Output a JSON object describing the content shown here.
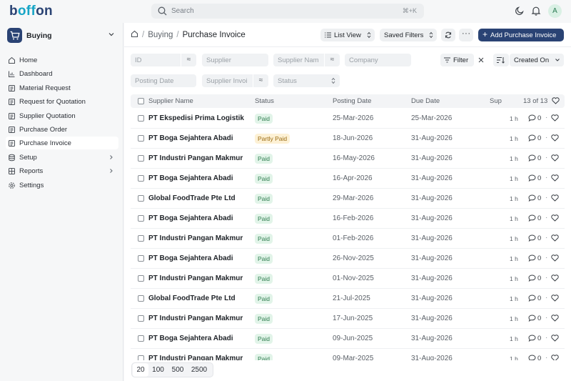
{
  "app": {
    "logo_prefix": "b",
    "logo_oo": "off",
    "logo_suffix": "on"
  },
  "search": {
    "placeholder": "Search",
    "shortcut": "⌘+K"
  },
  "user": {
    "avatar_letter": "A"
  },
  "workspace": {
    "label": "Buying"
  },
  "sidebar": {
    "items": [
      {
        "label": "Home",
        "icon": "home-icon"
      },
      {
        "label": "Dashboard",
        "icon": "chart-icon"
      },
      {
        "label": "Material Request",
        "icon": "doc-icon"
      },
      {
        "label": "Request for Quotation",
        "icon": "doc-icon"
      },
      {
        "label": "Supplier Quotation",
        "icon": "doc-icon"
      },
      {
        "label": "Purchase Order",
        "icon": "doc-icon"
      },
      {
        "label": "Purchase Invoice",
        "icon": "doc-icon",
        "active": true
      },
      {
        "label": "Setup",
        "icon": "db-icon",
        "chevron": true
      },
      {
        "label": "Reports",
        "icon": "grid-icon",
        "chevron": true
      },
      {
        "label": "Settings",
        "icon": "gear-icon"
      }
    ]
  },
  "breadcrumb": {
    "parent": "Buying",
    "current": "Purchase Invoice"
  },
  "toolbar": {
    "list_view": "List View",
    "saved_filters": "Saved Filters",
    "add_button": "Add Purchase Invoice"
  },
  "filters": {
    "id": "ID",
    "supplier": "Supplier",
    "supplier_name": "Supplier Nam",
    "company": "Company",
    "posting_date": "Posting Date",
    "supplier_invoice": "Supplier Invoi",
    "status": "Status",
    "filter_label": "Filter",
    "sort_label": "Created On"
  },
  "table": {
    "columns": {
      "supplier_name": "Supplier Name",
      "status": "Status",
      "posting_date": "Posting Date",
      "due_date": "Due Date",
      "sup": "Sup",
      "count": "13 of 13"
    },
    "rows": [
      {
        "name": "PT Ekspedisi Prima Logistik",
        "status": "Paid",
        "posting": "25-Mar-2026",
        "due": "25-Mar-2026",
        "age": "1 h",
        "comments": "0"
      },
      {
        "name": "PT Boga Sejahtera Abadi",
        "status": "Partly Paid",
        "posting": "18-Jun-2026",
        "due": "31-Aug-2026",
        "age": "1 h",
        "comments": "0"
      },
      {
        "name": "PT Industri Pangan Makmur",
        "status": "Paid",
        "posting": "16-May-2026",
        "due": "31-Aug-2026",
        "age": "1 h",
        "comments": "0"
      },
      {
        "name": "PT Boga Sejahtera Abadi",
        "status": "Paid",
        "posting": "16-Apr-2026",
        "due": "31-Aug-2026",
        "age": "1 h",
        "comments": "0"
      },
      {
        "name": "Global FoodTrade Pte Ltd",
        "status": "Paid",
        "posting": "29-Mar-2026",
        "due": "31-Aug-2026",
        "age": "1 h",
        "comments": "0"
      },
      {
        "name": "PT Boga Sejahtera Abadi",
        "status": "Paid",
        "posting": "16-Feb-2026",
        "due": "31-Aug-2026",
        "age": "1 h",
        "comments": "0"
      },
      {
        "name": "PT Industri Pangan Makmur",
        "status": "Paid",
        "posting": "01-Feb-2026",
        "due": "31-Aug-2026",
        "age": "1 h",
        "comments": "0"
      },
      {
        "name": "PT Boga Sejahtera Abadi",
        "status": "Paid",
        "posting": "26-Nov-2025",
        "due": "31-Aug-2026",
        "age": "1 h",
        "comments": "0"
      },
      {
        "name": "PT Industri Pangan Makmur",
        "status": "Paid",
        "posting": "01-Nov-2025",
        "due": "31-Aug-2026",
        "age": "1 h",
        "comments": "0"
      },
      {
        "name": "Global FoodTrade Pte Ltd",
        "status": "Paid",
        "posting": "21-Jul-2025",
        "due": "31-Aug-2026",
        "age": "1 h",
        "comments": "0"
      },
      {
        "name": "PT Industri Pangan Makmur",
        "status": "Paid",
        "posting": "17-Jun-2025",
        "due": "31-Aug-2026",
        "age": "1 h",
        "comments": "0"
      },
      {
        "name": "PT Boga Sejahtera Abadi",
        "status": "Paid",
        "posting": "09-Jun-2025",
        "due": "31-Aug-2026",
        "age": "1 h",
        "comments": "0"
      },
      {
        "name": "PT Industri Pangan Makmur",
        "status": "Paid",
        "posting": "09-Mar-2025",
        "due": "31-Aug-2026",
        "age": "1 h",
        "comments": "0"
      }
    ]
  },
  "page_sizes": [
    "20",
    "100",
    "500",
    "2500"
  ],
  "selected_page_size": "20",
  "colors": {
    "brand": "#2a4374",
    "accent": "#17a5c6",
    "paid": "#2f7d4f",
    "partly_paid": "#9a6b12"
  }
}
